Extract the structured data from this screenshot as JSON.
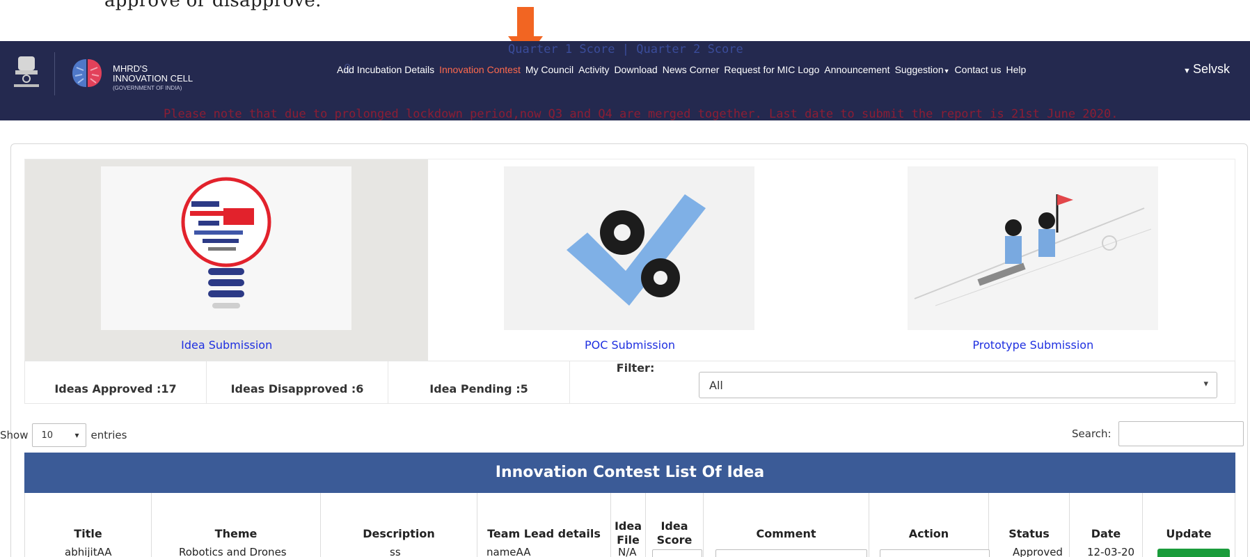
{
  "caption": "approve or disapprove.",
  "navbar": {
    "brand_line1": "MHRD'S",
    "brand_line2": "INNOVATION CELL",
    "brand_line3": "(GOVERNMENT OF INDIA)",
    "ghost_quarters": "Quarter 1 Score | Quarter 2 Score",
    "ghost_q": "Q",
    "ghost_note": "Please note that due to prolonged lockdown period,now Q3 and Q4 are merged together. Last date to submit the report is 21st June 2020.",
    "links": [
      {
        "label": "Add Incubation Details"
      },
      {
        "label": "Innovation Contest"
      },
      {
        "label": "My Council"
      },
      {
        "label": "Activity"
      },
      {
        "label": "Download"
      },
      {
        "label": "News Corner"
      },
      {
        "label": "Request for MIC Logo"
      },
      {
        "label": "Announcement"
      },
      {
        "label": "Suggestion"
      },
      {
        "label": "Contact us"
      },
      {
        "label": "Help"
      }
    ],
    "user": "Selvsk",
    "accent_color": "#ff6a4d"
  },
  "tiles": [
    {
      "label": "Idea Submission"
    },
    {
      "label": "POC Submission"
    },
    {
      "label": "Prototype Submission"
    }
  ],
  "stats": {
    "approved": "Ideas Approved :17",
    "disapproved": "Ideas Disapproved :6",
    "pending": "Idea Pending :5",
    "filter_label": "Filter:",
    "filter_value": "All"
  },
  "show": {
    "label_before": "Show",
    "value": "10",
    "label_after": "entries"
  },
  "search": {
    "label": "Search:"
  },
  "table": {
    "title": "Innovation Contest List Of Idea",
    "columns": [
      "Title",
      "Theme",
      "Description",
      "Team Lead details",
      "Idea File",
      "Idea Score",
      "Comment",
      "Action",
      "Status",
      "Date",
      "Update"
    ],
    "rows": [
      {
        "title": "abhijitAA",
        "theme": "Robotics and Drones",
        "description": "ss",
        "team_lead": "nameAA",
        "idea_file": "N/A",
        "status": "Approved",
        "date": "12-03-20"
      }
    ]
  },
  "colors": {
    "navbar": "#24294f",
    "table_header": "#3b5b97",
    "update_button": "#1a9c3b",
    "tile_label": "#1e2fe0"
  }
}
